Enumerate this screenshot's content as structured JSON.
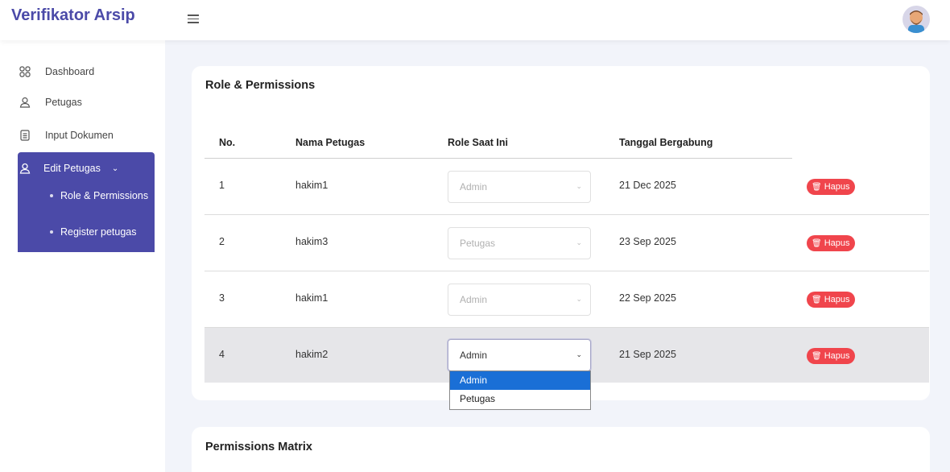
{
  "app": {
    "title": "Verifikator Arsip"
  },
  "sidebar": {
    "items": [
      {
        "label": "Dashboard"
      },
      {
        "label": "Petugas"
      },
      {
        "label": "Input Dokumen"
      }
    ],
    "active": {
      "label": "Edit Petugas",
      "children": [
        {
          "label": "Role & Permissions"
        },
        {
          "label": "Register petugas"
        }
      ]
    }
  },
  "main": {
    "card_title": "Role & Permissions",
    "columns": [
      "No.",
      "Nama Petugas",
      "Role Saat Ini",
      "Tanggal Bergabung"
    ],
    "rows": [
      {
        "no": "1",
        "name": "hakim1",
        "role": "Admin",
        "date": "21 Dec 2025",
        "action": "Hapus"
      },
      {
        "no": "2",
        "name": "hakim3",
        "role": "Petugas",
        "date": "23 Sep 2025",
        "action": "Hapus"
      },
      {
        "no": "3",
        "name": "hakim1",
        "role": "Admin",
        "date": "22 Sep 2025",
        "action": "Hapus"
      },
      {
        "no": "4",
        "name": "hakim2",
        "role": "Admin",
        "date": "21 Sep 2025",
        "action": "Hapus"
      }
    ],
    "dropdown_options": [
      "Admin",
      "Petugas"
    ],
    "dropdown_selected": "Admin",
    "matrix_title": "Permissions Matrix"
  },
  "colors": {
    "brand": "#4b4aa8",
    "danger": "#f0454c",
    "selected_option": "#1a6fd6"
  }
}
